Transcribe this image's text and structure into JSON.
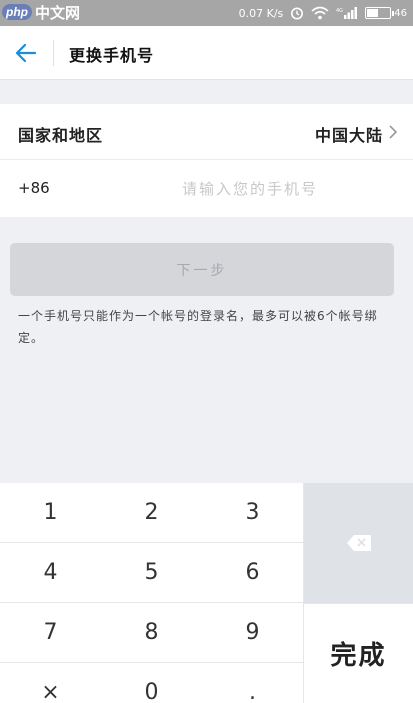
{
  "status_bar": {
    "logo_php": "php",
    "logo_text": "中文网",
    "net_speed": "0.07",
    "net_unit": "K/s",
    "signal_label": "4G",
    "battery_level": "46",
    "battery_fraction": 0.46,
    "icons": [
      "alarm-icon",
      "wifi-icon",
      "signal-icon",
      "battery-icon"
    ]
  },
  "header": {
    "back_icon": "arrow-left-icon",
    "title": "更换手机号",
    "accent_color": "#1a8ddb"
  },
  "form": {
    "region_label": "国家和地区",
    "region_value": "中国大陆",
    "country_code": "+86",
    "phone_placeholder": "请输入您的手机号",
    "phone_value": ""
  },
  "next_button": {
    "label": "下一步"
  },
  "hint": "一个手机号只能作为一个帐号的登录名，最多可以被6个帐号绑定。",
  "keypad": {
    "keys": [
      "1",
      "2",
      "3",
      "4",
      "5",
      "6",
      "7",
      "8",
      "9",
      "×",
      "0",
      "."
    ],
    "delete_icon": "backspace-icon",
    "done_label": "完成"
  }
}
